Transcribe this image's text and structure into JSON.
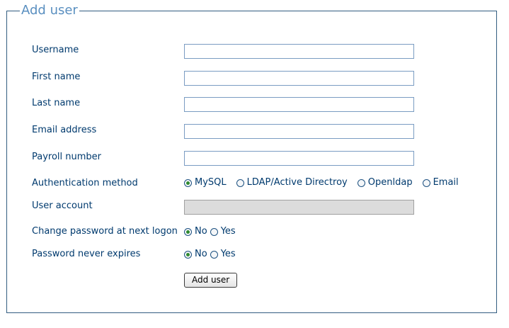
{
  "form": {
    "legend": "Add user",
    "fields": {
      "username": {
        "label": "Username",
        "value": ""
      },
      "first_name": {
        "label": "First name",
        "value": ""
      },
      "last_name": {
        "label": "Last name",
        "value": ""
      },
      "email": {
        "label": "Email address",
        "value": ""
      },
      "payroll": {
        "label": "Payroll number",
        "value": ""
      },
      "user_account": {
        "label": "User account",
        "value": ""
      }
    },
    "auth": {
      "label": "Authentication method",
      "options": [
        "MySQL",
        "LDAP/Active Directroy",
        "Openldap",
        "Email"
      ],
      "selected": "MySQL"
    },
    "change_password": {
      "label": "Change password at next logon",
      "options": [
        "No",
        "Yes"
      ],
      "selected": "No"
    },
    "never_expires": {
      "label": "Password never expires",
      "options": [
        "No",
        "Yes"
      ],
      "selected": "No"
    },
    "submit_label": "Add user"
  },
  "colors": {
    "label_text": "#003a6e",
    "legend_text": "#5a8fc0",
    "border": "#325d80",
    "radio_selected": "#2f8a2f"
  }
}
